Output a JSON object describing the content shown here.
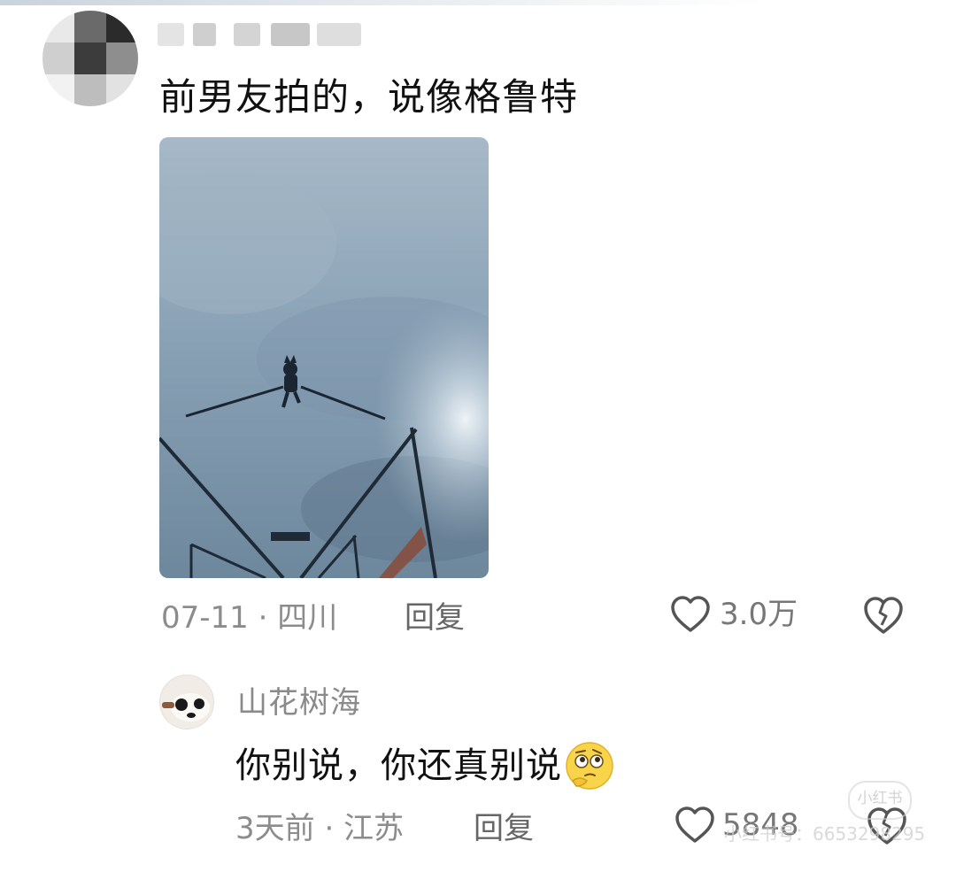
{
  "main_comment": {
    "text": "前男友拍的，说像格鲁特",
    "date": "07-11",
    "location": "四川",
    "reply_label": "回复",
    "like_count": "3.0万",
    "icons": {
      "like": "heart-icon",
      "dislike": "broken-heart-icon"
    }
  },
  "reply_comment": {
    "username": "山花树海",
    "text": "你别说，你还真别说",
    "emoji": "thinking-face-emoji",
    "date": "3天前",
    "location": "江苏",
    "reply_label": "回复",
    "like_count": "5848",
    "icons": {
      "like": "heart-icon",
      "dislike": "broken-heart-icon"
    }
  },
  "watermark": {
    "logo": "小红书",
    "id_text": "小红书号：6653298295"
  },
  "colors": {
    "text_primary": "#111111",
    "text_meta": "#8c8c8c",
    "sky": "#8aa2b6"
  }
}
